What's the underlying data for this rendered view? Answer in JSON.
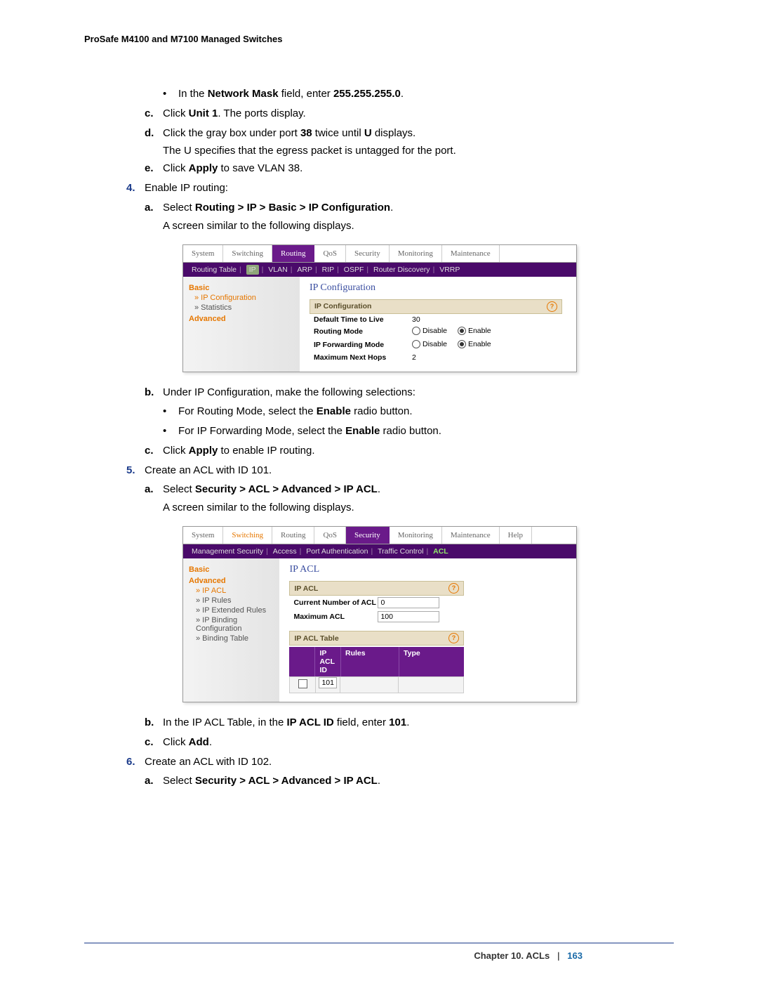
{
  "header": "ProSafe M4100 and M7100 Managed Switches",
  "footer": {
    "chapter": "Chapter 10.  ACLs",
    "sep": "|",
    "page": "163"
  },
  "bul1": {
    "pre": "In the ",
    "b1": "Network Mask",
    "mid": " field, enter ",
    "b2": "255.255.255.0",
    "post": "."
  },
  "stepC": {
    "pre": "Click ",
    "b1": "Unit 1",
    "post": ". The ports display."
  },
  "stepD_l1": {
    "pre": "Click the gray box under port ",
    "b1": "38",
    "mid": " twice until ",
    "b2": "U",
    "post": " displays."
  },
  "stepD_l2": "The U specifies that the egress packet is untagged for the port.",
  "stepE": {
    "pre": "Click ",
    "b1": "Apply",
    "post": " to save VLAN 38."
  },
  "step4": "Enable IP routing:",
  "step4a": {
    "pre": "Select ",
    "b1": "Routing > IP > Basic > IP Configuration",
    "post": "."
  },
  "step4a_l2": "A screen similar to the following displays.",
  "step4b": "Under IP Configuration, make the following selections:",
  "step4b_bul1": {
    "pre": "For Routing Mode, select the ",
    "b1": "Enable",
    "post": " radio button."
  },
  "step4b_bul2": {
    "pre": "For IP Forwarding Mode, select the ",
    "b1": "Enable",
    "post": " radio button."
  },
  "step4c": {
    "pre": "Click ",
    "b1": "Apply",
    "post": " to enable IP routing."
  },
  "step5": "Create an ACL with ID 101.",
  "step5a": {
    "pre": "Select ",
    "b1": "Security > ACL > Advanced > IP ACL",
    "post": "."
  },
  "step5a_l2": "A screen similar to the following displays.",
  "step5b": {
    "pre": "In the IP ACL Table, in the ",
    "b1": "IP ACL ID",
    "mid": " field, enter ",
    "b2": "101",
    "post": "."
  },
  "step5c": {
    "pre": "Click ",
    "b1": "Add",
    "post": "."
  },
  "step6": "Create an ACL with ID 102.",
  "step6a": {
    "pre": "Select ",
    "b1": "Security > ACL > Advanced > IP ACL",
    "post": "."
  },
  "shot1": {
    "tabs": [
      "System",
      "Switching",
      "Routing",
      "QoS",
      "Security",
      "Monitoring",
      "Maintenance"
    ],
    "subtabs": [
      "Routing Table",
      "IP",
      "VLAN",
      "ARP",
      "RIP",
      "OSPF",
      "Router Discovery",
      "VRRP"
    ],
    "side_basic": "Basic",
    "side_ipcfg": "» IP Configuration",
    "side_stats": "» Statistics",
    "side_adv": "Advanced",
    "title": "IP Configuration",
    "bar": "IP Configuration",
    "rows": {
      "ttl_lbl": "Default Time to Live",
      "ttl_val": "30",
      "routing_lbl": "Routing Mode",
      "disable": "Disable",
      "enable": "Enable",
      "fwd_lbl": "IP Forwarding Mode",
      "hops_lbl": "Maximum Next Hops",
      "hops_val": "2"
    }
  },
  "shot2": {
    "tabs": [
      "System",
      "Switching",
      "Routing",
      "QoS",
      "Security",
      "Monitoring",
      "Maintenance",
      "Help"
    ],
    "subtabs": [
      "Management Security",
      "Access",
      "Port Authentication",
      "Traffic Control",
      "ACL"
    ],
    "side_basic": "Basic",
    "side_adv": "Advanced",
    "side_ipacl": "» IP ACL",
    "side_iprules": "» IP Rules",
    "side_ipext": "» IP Extended Rules",
    "side_ipbind": "» IP Binding Configuration",
    "side_bindtbl": "» Binding Table",
    "title": "IP ACL",
    "bar1": "IP ACL",
    "curr_lbl": "Current Number of ACL",
    "curr_val": "0",
    "max_lbl": "Maximum ACL",
    "max_val": "100",
    "bar2": "IP ACL Table",
    "th_id": "IP ACL ID",
    "th_rules": "Rules",
    "th_type": "Type",
    "row_id": "101"
  }
}
